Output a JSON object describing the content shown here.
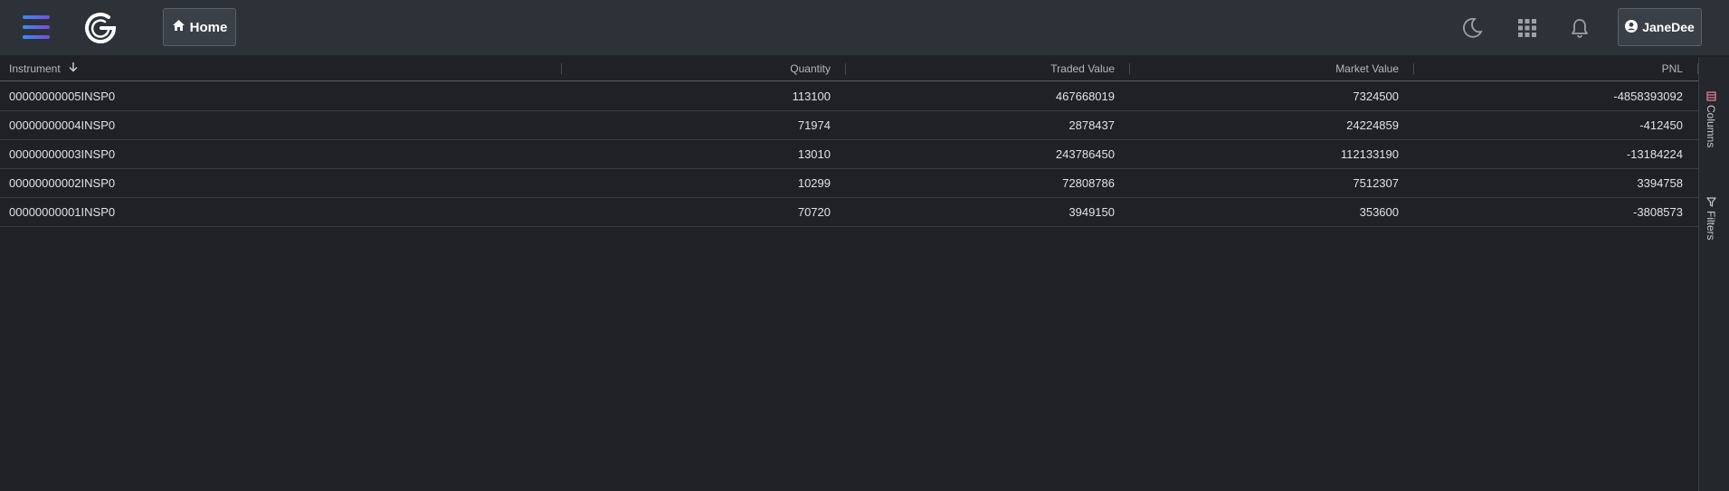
{
  "topbar": {
    "home_label": "Home",
    "user_label": "JaneDee",
    "icons": [
      "menu-icon",
      "app-logo",
      "home-icon",
      "moon-icon",
      "apps-grid-icon",
      "bell-icon",
      "user-circle-icon"
    ]
  },
  "grid": {
    "columns": [
      "Instrument",
      "Quantity",
      "Traded Value",
      "Market Value",
      "PNL"
    ],
    "sort_column": "Instrument",
    "sort_direction": "descending",
    "rows": [
      {
        "instrument": "00000000005INSP0",
        "quantity": "113100",
        "traded_value": "467668019",
        "market_value": "7324500",
        "pnl": "-4858393092"
      },
      {
        "instrument": "00000000004INSP0",
        "quantity": "71974",
        "traded_value": "2878437",
        "market_value": "24224859",
        "pnl": "-412450"
      },
      {
        "instrument": "00000000003INSP0",
        "quantity": "13010",
        "traded_value": "243786450",
        "market_value": "112133190",
        "pnl": "-13184224"
      },
      {
        "instrument": "00000000002INSP0",
        "quantity": "10299",
        "traded_value": "72808786",
        "market_value": "7512307",
        "pnl": "3394758"
      },
      {
        "instrument": "00000000001INSP0",
        "quantity": "70720",
        "traded_value": "3949150",
        "market_value": "353600",
        "pnl": "-3808573"
      }
    ]
  },
  "sidebar": {
    "columns_label": "Columns",
    "filters_label": "Filters"
  },
  "colors": {
    "topbar_bg": "#2d3238",
    "grid_bg": "#1f2127",
    "menu_gradient_start": "#3a8df0",
    "menu_gradient_end": "#7b4ce0"
  }
}
